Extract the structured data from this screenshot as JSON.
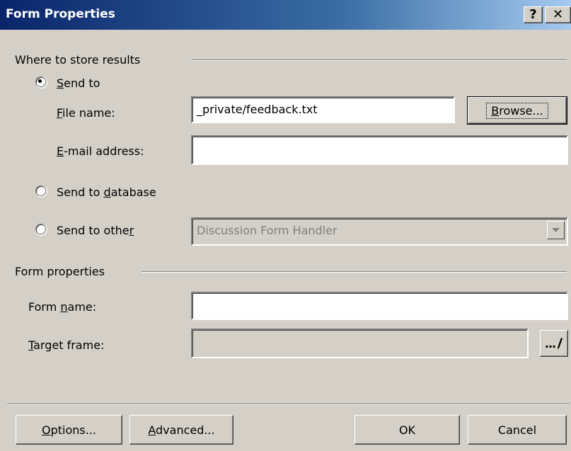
{
  "window": {
    "title": "Form Properties",
    "help_button": "?",
    "close_button": "✕"
  },
  "store_results": {
    "group_label": "Where to store results",
    "send_to": {
      "label": "Send to",
      "accel": "S",
      "rest": "end to",
      "checked": true
    },
    "file_name": {
      "accel": "F",
      "rest": "ile name:",
      "value": "_private/feedback.txt"
    },
    "browse_button": {
      "accel": "B",
      "rest": "rowse..."
    },
    "email": {
      "accel": "E",
      "rest": "-mail address:",
      "value": ""
    },
    "send_to_database": {
      "pre": "Send to ",
      "accel": "d",
      "rest": "atabase",
      "checked": false
    },
    "send_to_other": {
      "pre": "Send to othe",
      "accel": "r",
      "rest": "",
      "checked": false
    },
    "other_handler": {
      "value": "Discussion Form Handler",
      "enabled": false
    }
  },
  "form_props": {
    "group_label": "Form properties",
    "form_name": {
      "pre": "Form ",
      "accel": "n",
      "rest": "ame:",
      "value": ""
    },
    "target_frame": {
      "accel": "T",
      "rest": "arget frame:",
      "value": ""
    },
    "target_button": "..."
  },
  "footer": {
    "options": {
      "accel": "O",
      "rest": "ptions..."
    },
    "advanced": {
      "accel": "A",
      "rest": "dvanced..."
    },
    "ok": "OK",
    "cancel": "Cancel"
  }
}
